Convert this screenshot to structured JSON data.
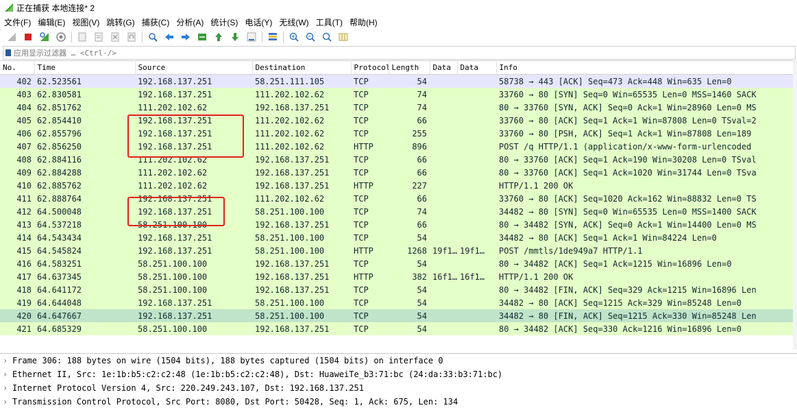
{
  "window": {
    "title": "正在捕获 本地连接* 2"
  },
  "menu": [
    "文件(F)",
    "编辑(E)",
    "视图(V)",
    "跳转(G)",
    "捕获(C)",
    "分析(A)",
    "统计(S)",
    "电话(Y)",
    "无线(W)",
    "工具(T)",
    "帮助(H)"
  ],
  "toolbar_icons": [
    "shark-fin-start-icon",
    "stop-icon",
    "restart-icon",
    "options-icon",
    "open-file-icon",
    "save-file-icon",
    "close-file-icon",
    "reload-icon",
    "find-icon",
    "go-back-icon",
    "go-forward-icon",
    "go-to-packet-icon",
    "first-packet-icon",
    "last-packet-icon",
    "auto-scroll-icon",
    "colorize-icon",
    "zoom-in-icon",
    "zoom-out-icon",
    "zoom-normal-icon",
    "resize-columns-icon"
  ],
  "filter": {
    "placeholder": "应用显示过滤器 … <Ctrl-/>"
  },
  "columns": [
    "No.",
    "Time",
    "Source",
    "Destination",
    "Protocol",
    "Length",
    "Data",
    "Data",
    "Info"
  ],
  "packets": [
    {
      "no": "402",
      "time": "62.523561",
      "src": "192.168.137.251",
      "dst": "58.251.111.105",
      "proto": "TCP",
      "len": "54",
      "d1": "",
      "d2": "",
      "info": "58738 → 443 [ACK] Seq=473 Ack=448 Win=635 Len=0",
      "style": "tcp"
    },
    {
      "no": "403",
      "time": "62.830581",
      "src": "192.168.137.251",
      "dst": "111.202.102.62",
      "proto": "TCP",
      "len": "74",
      "d1": "",
      "d2": "",
      "info": "33760 → 80 [SYN] Seq=0 Win=65535 Len=0 MSS=1460 SACK",
      "style": "grn"
    },
    {
      "no": "404",
      "time": "62.851762",
      "src": "111.202.102.62",
      "dst": "192.168.137.251",
      "proto": "TCP",
      "len": "74",
      "d1": "",
      "d2": "",
      "info": "80 → 33760 [SYN, ACK] Seq=0 Ack=1 Win=28960 Len=0 MS",
      "style": "grn"
    },
    {
      "no": "405",
      "time": "62.854410",
      "src": "192.168.137.251",
      "dst": "111.202.102.62",
      "proto": "TCP",
      "len": "66",
      "d1": "",
      "d2": "",
      "info": "33760 → 80 [ACK] Seq=1 Ack=1 Win=87808 Len=0 TSval=2",
      "style": "grn"
    },
    {
      "no": "406",
      "time": "62.855796",
      "src": "192.168.137.251",
      "dst": "111.202.102.62",
      "proto": "TCP",
      "len": "255",
      "d1": "",
      "d2": "",
      "info": "33760 → 80 [PSH, ACK] Seq=1 Ack=1 Win=87808 Len=189",
      "style": "grn"
    },
    {
      "no": "407",
      "time": "62.856250",
      "src": "192.168.137.251",
      "dst": "111.202.102.62",
      "proto": "HTTP",
      "len": "896",
      "d1": "",
      "d2": "",
      "info": "POST /q HTTP/1.1  (application/x-www-form-urlencoded",
      "style": "grn"
    },
    {
      "no": "408",
      "time": "62.884116",
      "src": "111.202.102.62",
      "dst": "192.168.137.251",
      "proto": "TCP",
      "len": "66",
      "d1": "",
      "d2": "",
      "info": "80 → 33760 [ACK] Seq=1 Ack=190 Win=30208 Len=0 TSval",
      "style": "grn"
    },
    {
      "no": "409",
      "time": "62.884288",
      "src": "111.202.102.62",
      "dst": "192.168.137.251",
      "proto": "TCP",
      "len": "66",
      "d1": "",
      "d2": "",
      "info": "80 → 33760 [ACK] Seq=1 Ack=1020 Win=31744 Len=0 TSva",
      "style": "grn"
    },
    {
      "no": "410",
      "time": "62.885762",
      "src": "111.202.102.62",
      "dst": "192.168.137.251",
      "proto": "HTTP",
      "len": "227",
      "d1": "",
      "d2": "",
      "info": "HTTP/1.1 200 OK",
      "style": "grn"
    },
    {
      "no": "411",
      "time": "62.888764",
      "src": "192.168.137.251",
      "dst": "111.202.102.62",
      "proto": "TCP",
      "len": "66",
      "d1": "",
      "d2": "",
      "info": "33760 → 80 [ACK] Seq=1020 Ack=162 Win=88832 Len=0 TS",
      "style": "grn"
    },
    {
      "no": "412",
      "time": "64.500048",
      "src": "192.168.137.251",
      "dst": "58.251.100.100",
      "proto": "TCP",
      "len": "74",
      "d1": "",
      "d2": "",
      "info": "34482 → 80 [SYN] Seq=0 Win=65535 Len=0 MSS=1400 SACK",
      "style": "grn"
    },
    {
      "no": "413",
      "time": "64.537218",
      "src": "58.251.100.100",
      "dst": "192.168.137.251",
      "proto": "TCP",
      "len": "66",
      "d1": "",
      "d2": "",
      "info": "80 → 34482 [SYN, ACK] Seq=0 Ack=1 Win=14400 Len=0 MS",
      "style": "grn"
    },
    {
      "no": "414",
      "time": "64.543434",
      "src": "192.168.137.251",
      "dst": "58.251.100.100",
      "proto": "TCP",
      "len": "54",
      "d1": "",
      "d2": "",
      "info": "34482 → 80 [ACK] Seq=1 Ack=1 Win=84224 Len=0",
      "style": "grn"
    },
    {
      "no": "415",
      "time": "64.545824",
      "src": "192.168.137.251",
      "dst": "58.251.100.100",
      "proto": "HTTP",
      "len": "1268",
      "d1": "19f1…",
      "d2": "19f1…",
      "info": "POST /mmtls/1de949a7 HTTP/1.1",
      "style": "grn"
    },
    {
      "no": "416",
      "time": "64.583251",
      "src": "58.251.100.100",
      "dst": "192.168.137.251",
      "proto": "TCP",
      "len": "54",
      "d1": "",
      "d2": "",
      "info": "80 → 34482 [ACK] Seq=1 Ack=1215 Win=16896 Len=0",
      "style": "grn"
    },
    {
      "no": "417",
      "time": "64.637345",
      "src": "58.251.100.100",
      "dst": "192.168.137.251",
      "proto": "HTTP",
      "len": "382",
      "d1": "16f1…",
      "d2": "16f1…",
      "info": "HTTP/1.1 200 OK",
      "style": "grn"
    },
    {
      "no": "418",
      "time": "64.641172",
      "src": "58.251.100.100",
      "dst": "192.168.137.251",
      "proto": "TCP",
      "len": "54",
      "d1": "",
      "d2": "",
      "info": "80 → 34482 [FIN, ACK] Seq=329 Ack=1215 Win=16896 Len",
      "style": "grn"
    },
    {
      "no": "419",
      "time": "64.644048",
      "src": "192.168.137.251",
      "dst": "58.251.100.100",
      "proto": "TCP",
      "len": "54",
      "d1": "",
      "d2": "",
      "info": "34482 → 80 [ACK] Seq=1215 Ack=329 Win=85248 Len=0",
      "style": "grn"
    },
    {
      "no": "420",
      "time": "64.647667",
      "src": "192.168.137.251",
      "dst": "58.251.100.100",
      "proto": "TCP",
      "len": "54",
      "d1": "",
      "d2": "",
      "info": "34482 → 80 [FIN, ACK] Seq=1215 Ack=330 Win=85248 Len",
      "style": "sel"
    },
    {
      "no": "421",
      "time": "64.685329",
      "src": "58.251.100.100",
      "dst": "192.168.137.251",
      "proto": "TCP",
      "len": "54",
      "d1": "",
      "d2": "",
      "info": "80 → 34482 [ACK] Seq=330 Ack=1216 Win=16896 Len=0",
      "style": "grn"
    }
  ],
  "details": [
    "Frame 306: 188 bytes on wire (1504 bits), 188 bytes captured (1504 bits) on interface 0",
    "Ethernet II, Src: 1e:1b:b5:c2:c2:48 (1e:1b:b5:c2:c2:48), Dst: HuaweiTe_b3:71:bc (24:da:33:b3:71:bc)",
    "Internet Protocol Version 4, Src: 220.249.243.107, Dst: 192.168.137.251",
    "Transmission Control Protocol, Src Port: 8080, Dst Port: 50428, Seq: 1, Ack: 675, Len: 134"
  ],
  "colors": {
    "tcp_row": "#e7e6ff",
    "green_row": "#e4ffc7",
    "selected_row": "#c0e4c9",
    "highlight": "#e2231a"
  }
}
